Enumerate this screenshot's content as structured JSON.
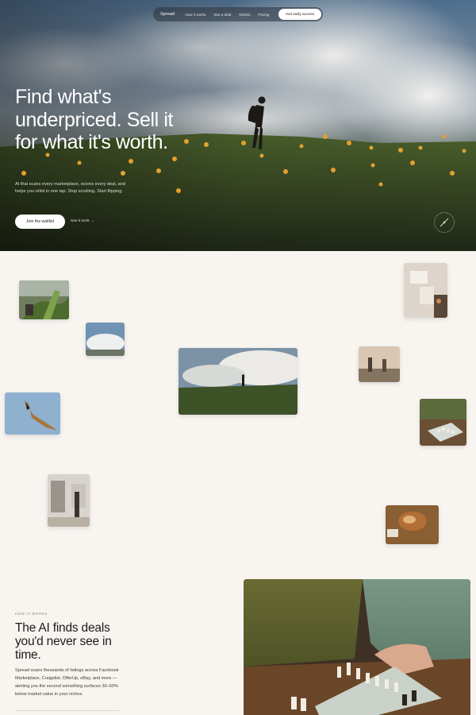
{
  "nav": {
    "brand": "Spread",
    "links": [
      "How it works",
      "See a deal",
      "Niches",
      "Pricing"
    ],
    "cta": "Get early access"
  },
  "hero": {
    "headline": "Find what's underpriced. Sell it for what it's worth.",
    "subhead": "AI that scans every marketplace, scores every deal, and helps you relist in one tap. Stop scrolling. Start flipping.",
    "primary_button": "Join the waitlist",
    "secondary_link": "See it work →"
  },
  "how": {
    "eyebrow": "HOW IT WORKS",
    "title": "The AI finds deals you'd never see in time.",
    "body": "Spread scans thousands of listings across Facebook Marketplace, Craigslist, OfferUp, eBay, and more — alerting you the second something surfaces 30–60% below market value in your niches."
  },
  "colors": {
    "page_bg": "#f8f5f1",
    "hero_text": "#ffffff",
    "ink": "#1d1b18"
  }
}
